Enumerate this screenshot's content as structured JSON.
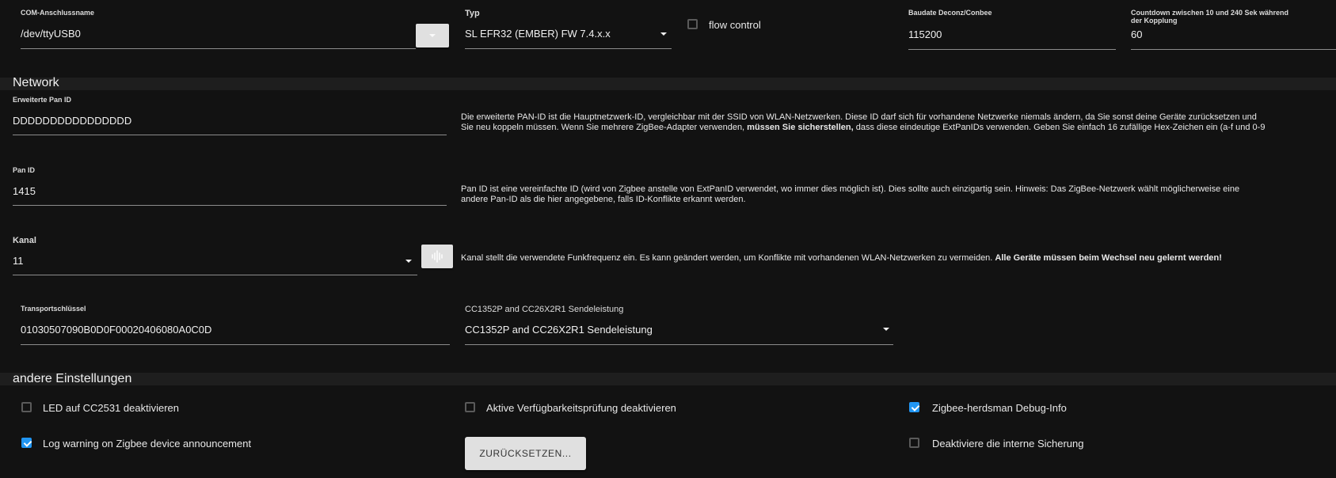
{
  "top": {
    "com_label": "COM-Anschlussname",
    "com_value": "/dev/ttyUSB0",
    "typ_label": "Typ",
    "typ_value": "SL EFR32 (EMBER) FW 7.4.x.x",
    "flow_label": "flow control",
    "baud_label": "Baudate Deconz/Conbee",
    "baud_value": "115200",
    "countdown_label": "Countdown zwischen 10 und 240 Sek während der Kopplung",
    "countdown_value": "60"
  },
  "network": {
    "title": "Network",
    "ext_pan_label": "Erweiterte Pan ID",
    "ext_pan_value": "DDDDDDDDDDDDDDDD",
    "ext_pan_desc_1": "Die erweiterte PAN-ID ist die Hauptnetzwerk-ID, vergleichbar mit der SSID von WLAN-Netzwerken. Diese ID darf sich für vorhandene Netzwerke niemals ändern, da Sie sonst deine Geräte zurücksetzen und",
    "ext_pan_desc_2a": "Sie neu koppeln müssen. Wenn Sie mehrere ZigBee-Adapter verwenden, ",
    "ext_pan_desc_2b": "müssen Sie sicherstellen,",
    "ext_pan_desc_2c": " dass diese eindeutige ExtPanIDs verwenden. Geben Sie einfach 16 zufällige Hex-Zeichen ein (a-f und 0-9",
    "pan_label": "Pan ID",
    "pan_value": "1415",
    "pan_desc_1": "Pan ID ist eine vereinfachte ID (wird von Zigbee anstelle von ExtPanID verwendet, wo immer dies möglich ist). Dies sollte auch einzigartig sein. Hinweis: Das ZigBee-Netzwerk wählt möglicherweise eine",
    "pan_desc_2": "andere Pan-ID als die hier angegebene, falls ID-Konflikte erkannt werden.",
    "kanal_label": "Kanal",
    "kanal_value": "11",
    "kanal_desc_a": "Kanal stellt die verwendete Funkfrequenz ein. Es kann geändert werden, um Konflikte mit vorhandenen WLAN-Netzwerken zu vermeiden. ",
    "kanal_desc_b": "Alle Geräte müssen beim Wechsel neu gelernt werden!",
    "transport_label": "Transportschlüssel",
    "transport_value": "01030507090B0D0F00020406080A0C0D",
    "power_label": "CC1352P and CC26X2R1 Sendeleistung",
    "power_value": "CC1352P and CC26X2R1 Sendeleistung"
  },
  "other": {
    "title": "andere Einstellungen",
    "led_label": "LED auf CC2531 deaktivieren",
    "led_checked": false,
    "avail_label": "Aktive Verfügbarkeitsprüfung deaktivieren",
    "avail_checked": false,
    "debug_label": "Zigbee-herdsman Debug-Info",
    "debug_checked": true,
    "logwarn_label": "Log warning on Zigbee device announcement",
    "logwarn_checked": true,
    "reset_label": "ZURÜCKSETZEN...",
    "backup_label": "Deaktiviere die interne Sicherung",
    "backup_checked": false
  }
}
